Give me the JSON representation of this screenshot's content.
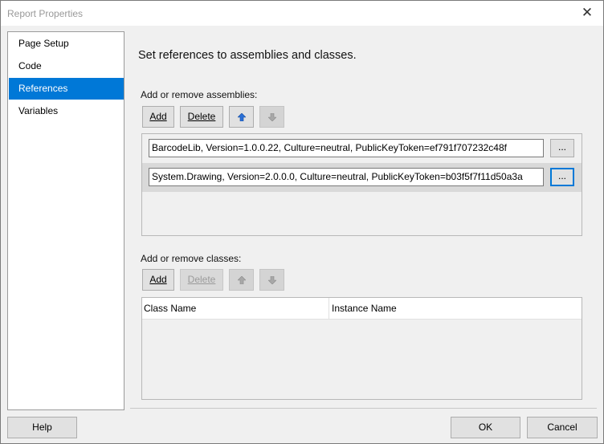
{
  "window": {
    "title": "Report Properties",
    "close_glyph": "✕",
    "close_icon": "close-icon"
  },
  "nav": {
    "items": [
      {
        "label": "Page Setup",
        "selected": false
      },
      {
        "label": "Code",
        "selected": false
      },
      {
        "label": "References",
        "selected": true
      },
      {
        "label": "Variables",
        "selected": false
      }
    ]
  },
  "main": {
    "heading": "Set references to assemblies and classes.",
    "assemblies": {
      "label": "Add or remove assemblies:",
      "add_label": "Add",
      "delete_label": "Delete",
      "move_up_icon": "arrow-up-icon",
      "move_down_icon": "arrow-down-icon",
      "items": [
        {
          "value": "BarcodeLib, Version=1.0.0.22, Culture=neutral, PublicKeyToken=ef791f707232c48f",
          "browse_label": "...",
          "selected": false
        },
        {
          "value": "System.Drawing, Version=2.0.0.0, Culture=neutral, PublicKeyToken=b03f5f7f11d50a3a",
          "browse_label": "...",
          "selected": true
        }
      ]
    },
    "classes": {
      "label": "Add or remove classes:",
      "add_label": "Add",
      "delete_label": "Delete",
      "delete_enabled": false,
      "columns": [
        "Class Name",
        "Instance Name"
      ],
      "rows": []
    }
  },
  "footer": {
    "help_label": "Help",
    "ok_label": "OK",
    "cancel_label": "Cancel"
  },
  "colors": {
    "accent": "#0078d7",
    "selected_row": "#d9d9d9",
    "dialog_bg": "#f0f0f0"
  }
}
